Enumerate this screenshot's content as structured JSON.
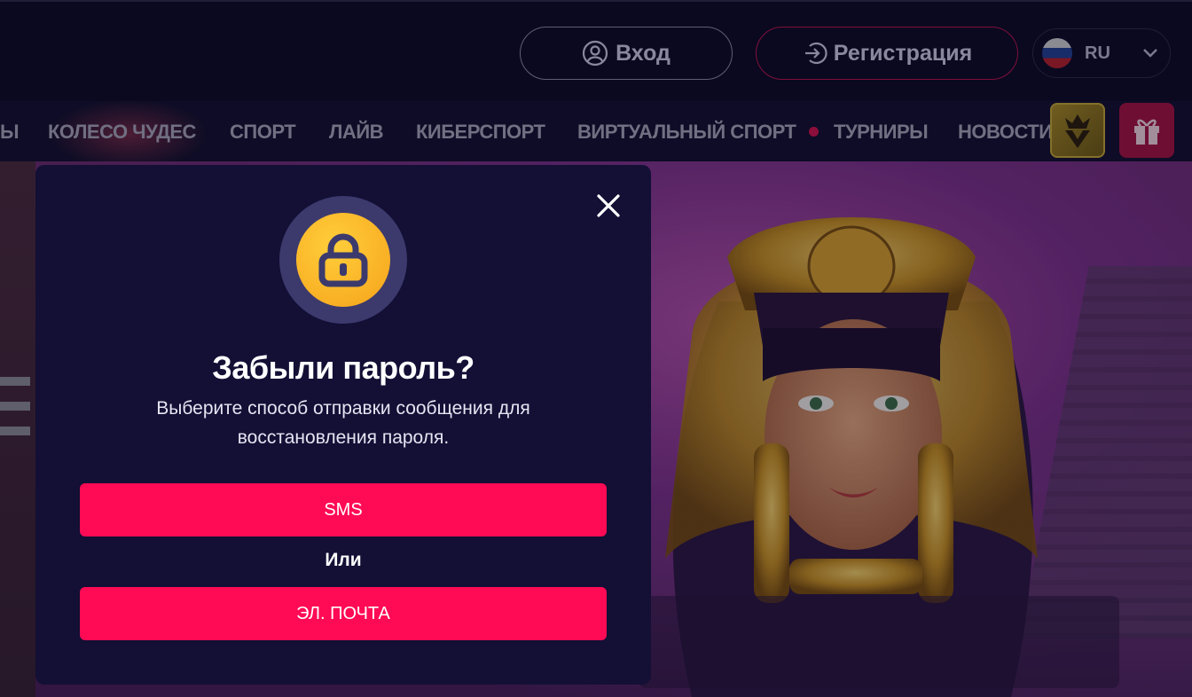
{
  "header": {
    "login_label": "Вход",
    "register_label": "Регистрация",
    "language": "RU"
  },
  "nav": {
    "items": [
      "Ы",
      "КОЛЕСО ЧУДЕС",
      "СПОРТ",
      "ЛАЙВ",
      "КИБЕРСПОРТ",
      "ВИРТУАЛЬНЫЙ СПОРТ",
      "ТУРНИРЫ",
      "НОВОСТИ"
    ]
  },
  "modal": {
    "title": "Забыли пароль?",
    "subtitle": "Выберите способ отправки сообщения для восстановления пароля.",
    "sms_label": "SMS",
    "or_label": "Или",
    "email_label": "ЭЛ. ПОЧТА"
  },
  "colors": {
    "accent": "#ff0a55",
    "modal_bg": "#130f35",
    "lock_yellow": "#ffc12a"
  },
  "icons": [
    "user-icon",
    "login-arrow-icon",
    "russia-flag-icon",
    "chevron-down-icon",
    "vip-crown-icon",
    "gift-icon",
    "close-icon",
    "lock-icon"
  ]
}
